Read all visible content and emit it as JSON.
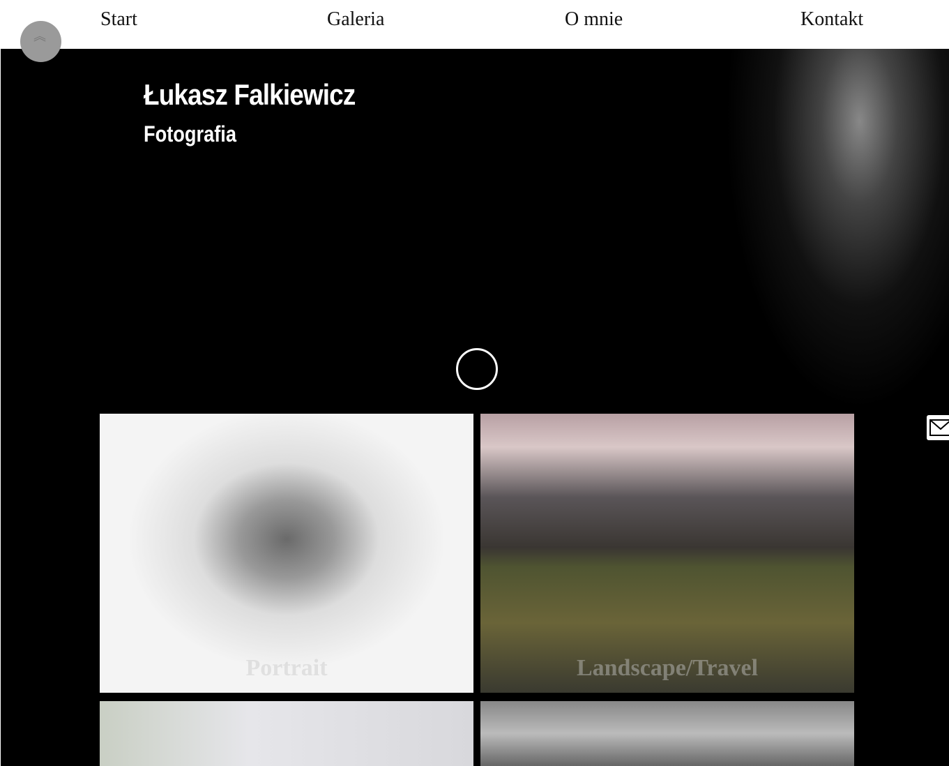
{
  "nav": {
    "items": [
      "Start",
      "Galeria",
      "O mnie",
      "Kontakt"
    ]
  },
  "hero": {
    "title": "Łukasz Falkiewicz",
    "subtitle": "Fotografia"
  },
  "gallery": [
    {
      "label": "Portrait"
    },
    {
      "label": "Landscape/Travel"
    },
    {
      "label": ""
    },
    {
      "label": ""
    }
  ]
}
